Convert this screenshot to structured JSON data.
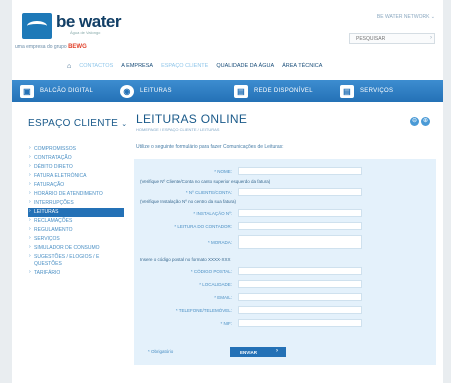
{
  "header": {
    "logo_text": "be water",
    "logo_sub": "Água de Valongo",
    "tagline_prefix": "uma empresa do grupo",
    "tagline_brand": "BEWG",
    "network": "BE WATER NETWORK ⌄",
    "search_placeholder": "PESQUISAR"
  },
  "topnav": {
    "items": [
      "CONTACTOS",
      "A EMPRESA",
      "ESPAÇO CLIENTE",
      "QUALIDADE DA ÁGUA",
      "ÁREA TÉCNICA"
    ]
  },
  "bluebar": {
    "items": [
      "BALCÃO DIGITAL",
      "LEITURAS",
      "REDE DISPONÍVEL",
      "SERVIÇOS"
    ]
  },
  "sidebar": {
    "title": "ESPAÇO CLIENTE",
    "items": [
      "COMPROMISSOS",
      "CONTRATAÇÃO",
      "DÉBITO DIRETO",
      "FATURA ELETRÓNICA",
      "FATURAÇÃO",
      "HORÁRIO DE ATENDIMENTO",
      "INTERRUPÇÕES",
      "LEITURAS",
      "RECLAMAÇÕES",
      "REGULAMENTO",
      "SERVIÇOS",
      "SIMULADOR DE CONSUMO",
      "SUGESTÕES / ELOGIOS / E QUESTÕES",
      "TARIFÁRIO"
    ],
    "active": "LEITURAS"
  },
  "main": {
    "title": "LEITURAS ONLINE",
    "breadcrumb": "HOMEPAGE / ESPAÇO CLIENTE / LEITURAS",
    "intro": "Utilize o seguinte formulário para fazer Comunicações de Leituras:",
    "form": {
      "nome": "* NOME:",
      "note1": "(Verifique Nº Cliente/Conta no canto superior esquerdo da fatura)",
      "cliente": "* Nº CLIENTE/CONTA:",
      "note2": "(Verifique Instalação Nº no centro da sua fatura)",
      "instalacao": "* INSTALAÇÃO Nº:",
      "leitura": "* LEITURA DO CONTADOR:",
      "morada": "* MORADA:",
      "note3": "Insere o código postal no formato XXXX-XXX",
      "codigo": "* CÓDIGO POSTAL:",
      "localidade": "* LOCALIDADE:",
      "email": "* EMAIL:",
      "telefone": "* TELEFONE/TELEMÓVEL:",
      "nif": "* NIF:",
      "obrigatorio": "* Obrigatório",
      "submit": "ENVIAR"
    }
  },
  "colors": {
    "primary": "#2471b6",
    "panel": "#e4f1fb",
    "accent_red": "#e0402a"
  }
}
